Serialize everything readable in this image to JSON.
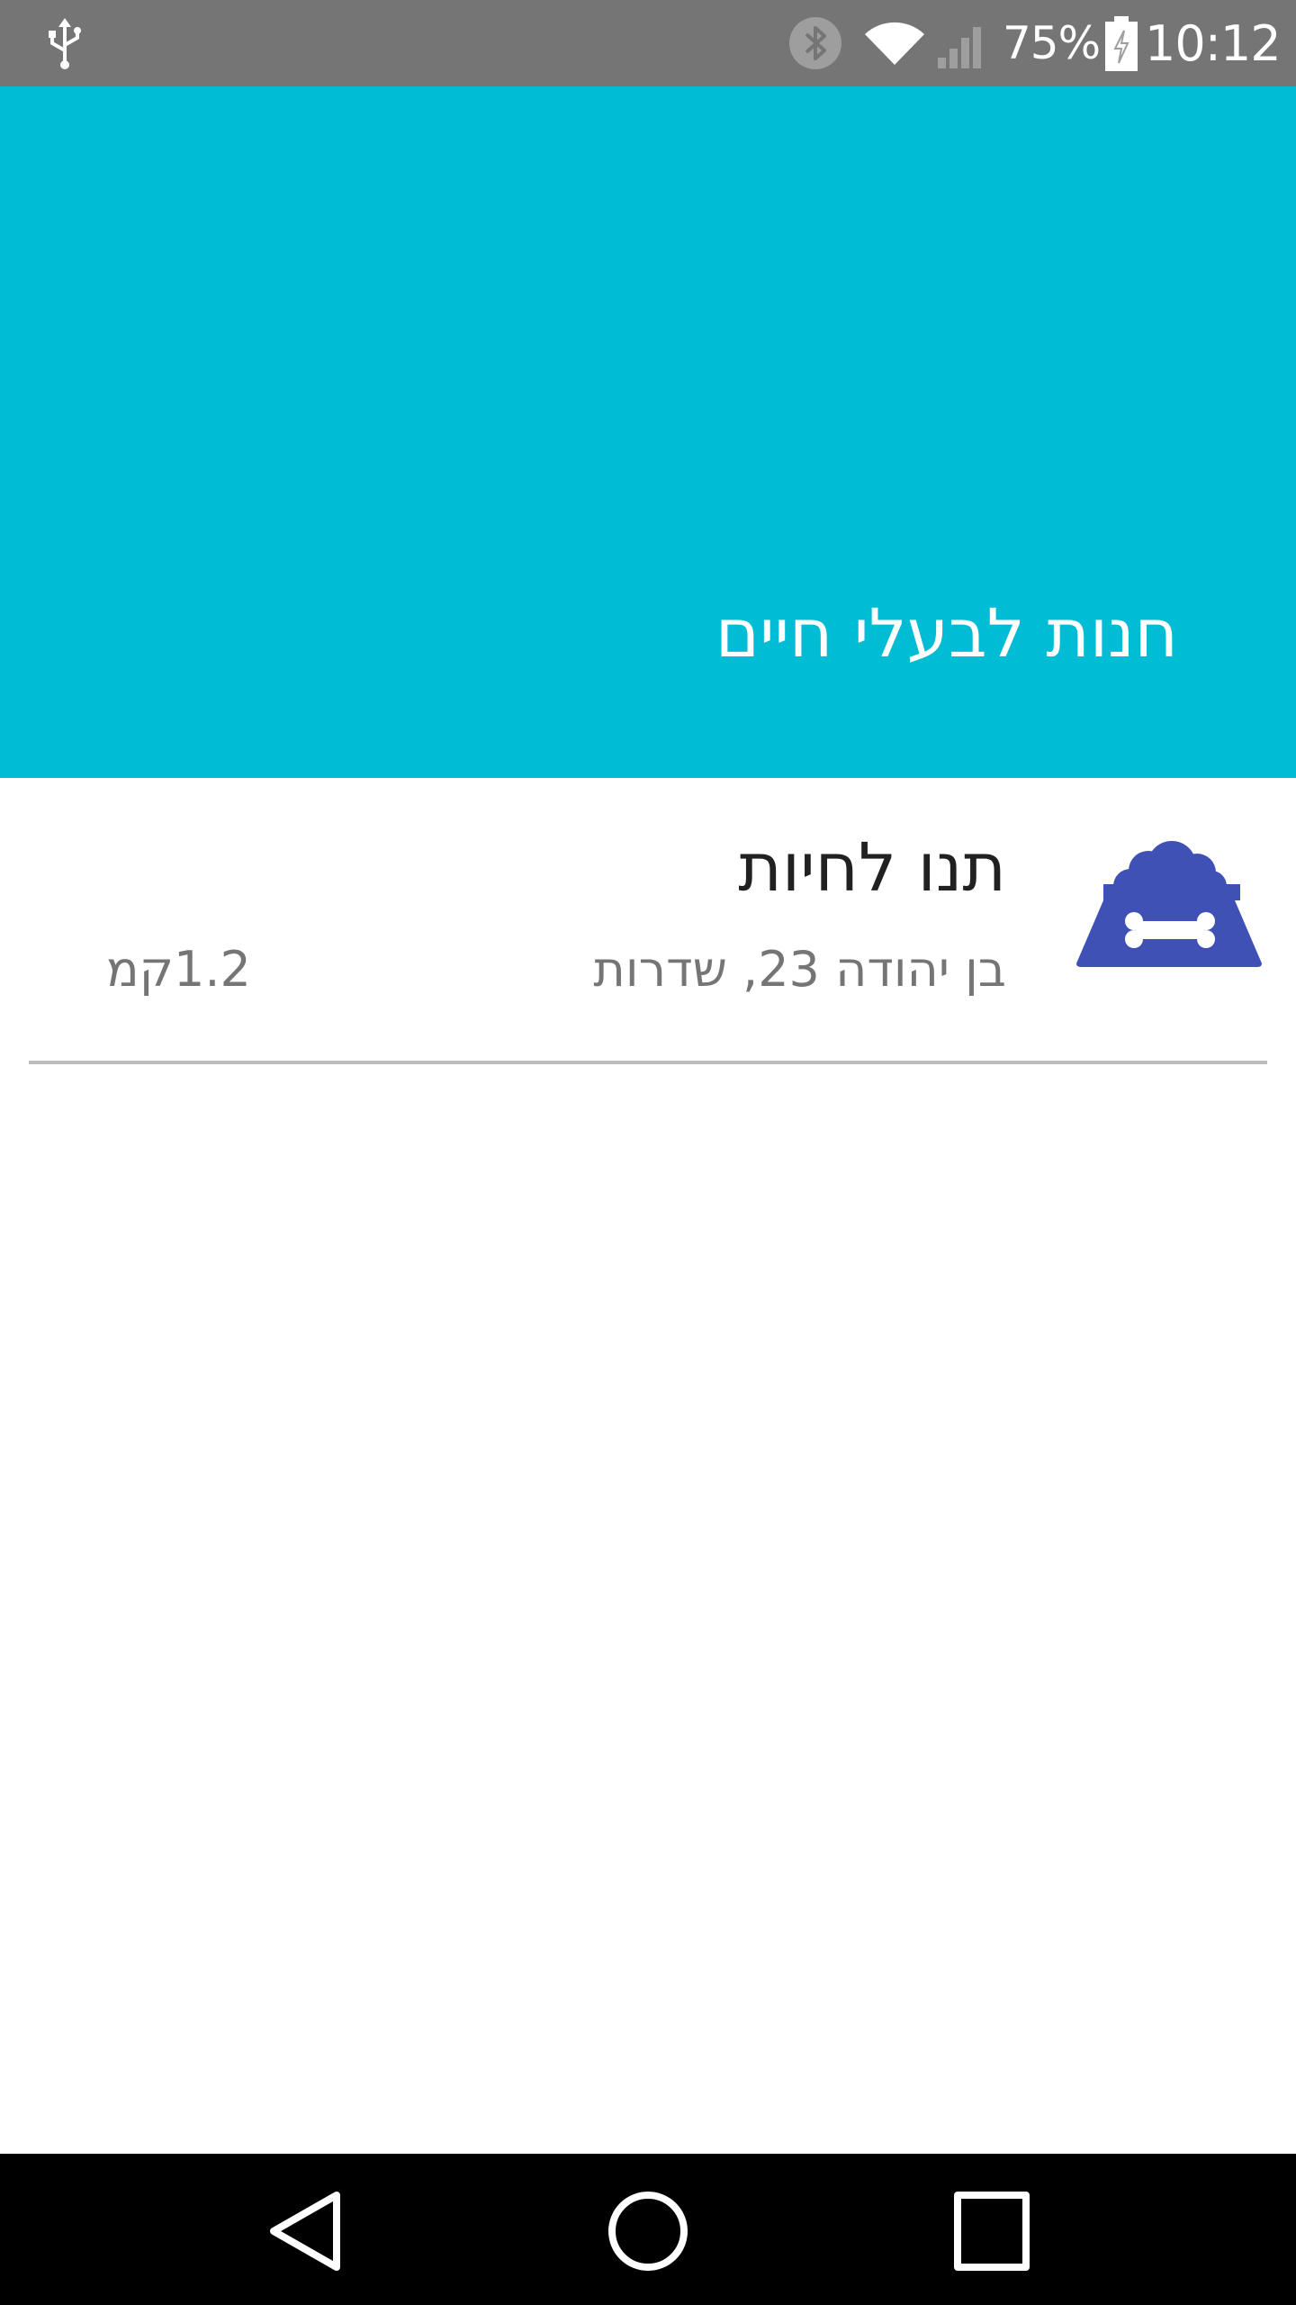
{
  "status_bar": {
    "battery_percent": "75%",
    "time": "10:12",
    "background_color": "#757575",
    "icons": [
      "usb-icon",
      "bluetooth-icon",
      "wifi-icon",
      "signal-icon",
      "battery-charging-icon"
    ]
  },
  "header": {
    "title": "חנות לבעלי חיים",
    "background_color": "#00BCD4"
  },
  "stores": [
    {
      "icon": "pet-food-bowl-icon",
      "icon_color": "#3F51B5",
      "name": "תנו לחיות",
      "address": "בן יהודה 23, שדרות",
      "distance": "1.2קמ"
    }
  ],
  "nav_bar": {
    "icons": [
      "back-icon",
      "home-icon",
      "recents-icon"
    ]
  }
}
